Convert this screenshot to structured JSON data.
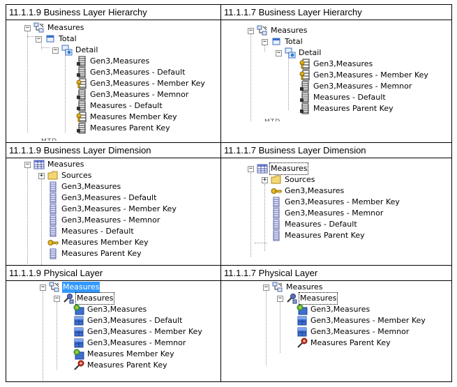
{
  "panels": [
    {
      "title": "11.1.1.9  Business Layer Hierarchy",
      "rows": [
        {
          "label": "Measures",
          "icon": "logical-table-hierarchy-icon",
          "exp": "−"
        },
        {
          "label": "Total",
          "icon": "level-total-icon",
          "exp": "−"
        },
        {
          "label": "Detail",
          "icon": "level-detail-icon",
          "exp": "−"
        },
        {
          "label": "Gen3,Measures",
          "icon": "column-icon"
        },
        {
          "label": "Gen3,Measures - Default",
          "icon": "column-icon"
        },
        {
          "label": "Gen3,Measures - Member Key",
          "icon": "key-column-icon"
        },
        {
          "label": "Gen3,Measures - Memnor",
          "icon": "column-icon"
        },
        {
          "label": "Measures - Default",
          "icon": "column-icon"
        },
        {
          "label": "Measures Member Key",
          "icon": "key-column-icon"
        },
        {
          "label": "Measures Parent Key",
          "icon": "column-icon"
        }
      ],
      "trailing": "MTD"
    },
    {
      "title": "11.1.1.7  Business Layer Hierarchy",
      "rows": [
        {
          "label": "Measures",
          "icon": "logical-table-hierarchy-icon",
          "exp": "−"
        },
        {
          "label": "Total",
          "icon": "level-total-icon",
          "exp": "−"
        },
        {
          "label": "Detail",
          "icon": "level-detail-icon",
          "exp": "−"
        },
        {
          "label": "Gen3,Measures",
          "icon": "key-column-icon"
        },
        {
          "label": "Gen3,Measures - Member Key",
          "icon": "key-column-icon"
        },
        {
          "label": "Gen3,Measures - Memnor",
          "icon": "column-icon"
        },
        {
          "label": "Measures - Default",
          "icon": "column-icon"
        },
        {
          "label": "Measures Parent Key",
          "icon": "column-icon"
        }
      ],
      "trailing": "MTD"
    },
    {
      "title": "11.1.1.9  Business Layer Dimension",
      "rows": [
        {
          "label": "Measures",
          "icon": "table-icon",
          "exp": "−"
        },
        {
          "label": "Sources",
          "icon": "folder-icon",
          "exp": "+"
        },
        {
          "label": "Gen3,Measures",
          "icon": "logical-column-icon"
        },
        {
          "label": "Gen3,Measures - Default",
          "icon": "logical-column-icon"
        },
        {
          "label": "Gen3,Measures - Member Key",
          "icon": "logical-column-icon"
        },
        {
          "label": "Gen3,Measures - Memnor",
          "icon": "logical-column-icon"
        },
        {
          "label": "Measures - Default",
          "icon": "logical-column-icon"
        },
        {
          "label": "Measures Member Key",
          "icon": "key-icon"
        },
        {
          "label": "Measures Parent Key",
          "icon": "logical-column-icon"
        }
      ]
    },
    {
      "title": "11.1.1.7  Business Layer Dimension",
      "rows": [
        {
          "label": "Measures",
          "icon": "table-icon",
          "exp": "−"
        },
        {
          "label": "Sources",
          "icon": "folder-icon",
          "exp": "+"
        },
        {
          "label": "Gen3,Measures",
          "icon": "key-icon"
        },
        {
          "label": "Gen3,Measures - Member Key",
          "icon": "logical-column-icon"
        },
        {
          "label": "Gen3,Measures - Memnor",
          "icon": "logical-column-icon"
        },
        {
          "label": "Measures - Default",
          "icon": "logical-column-icon"
        },
        {
          "label": "Measures Parent Key",
          "icon": "logical-column-icon"
        }
      ]
    },
    {
      "title": "11.1.1.9  Physical Layer",
      "rows": [
        {
          "label": "Measures",
          "icon": "physical-hierarchy-icon",
          "exp": "−"
        },
        {
          "label": "Measures",
          "icon": "physical-dimension-icon",
          "exp": "−"
        },
        {
          "label": "Gen3,Measures",
          "icon": "physical-key-column-icon"
        },
        {
          "label": "Gen3,Measures - Default",
          "icon": "physical-column-icon"
        },
        {
          "label": "Gen3,Measures - Member Key",
          "icon": "physical-column-icon"
        },
        {
          "label": "Gen3,Measures - Memnor",
          "icon": "physical-column-icon"
        },
        {
          "label": "Measures Member Key",
          "icon": "physical-key-column-icon"
        },
        {
          "label": "Measures Parent Key",
          "icon": "physical-parent-key-icon"
        }
      ]
    },
    {
      "title": "11.1.1.7  Physical Layer",
      "rows": [
        {
          "label": "Measures",
          "icon": "physical-hierarchy-icon",
          "exp": "−"
        },
        {
          "label": "Measures",
          "icon": "physical-dimension-icon",
          "exp": "−"
        },
        {
          "label": "Gen3,Measures",
          "icon": "physical-key-column-icon"
        },
        {
          "label": "Gen3,Measures - Member Key",
          "icon": "physical-column-icon"
        },
        {
          "label": "Gen3,Measures - Memnor",
          "icon": "physical-column-icon"
        },
        {
          "label": "Measures Parent Key",
          "icon": "physical-parent-key-icon"
        }
      ]
    }
  ]
}
